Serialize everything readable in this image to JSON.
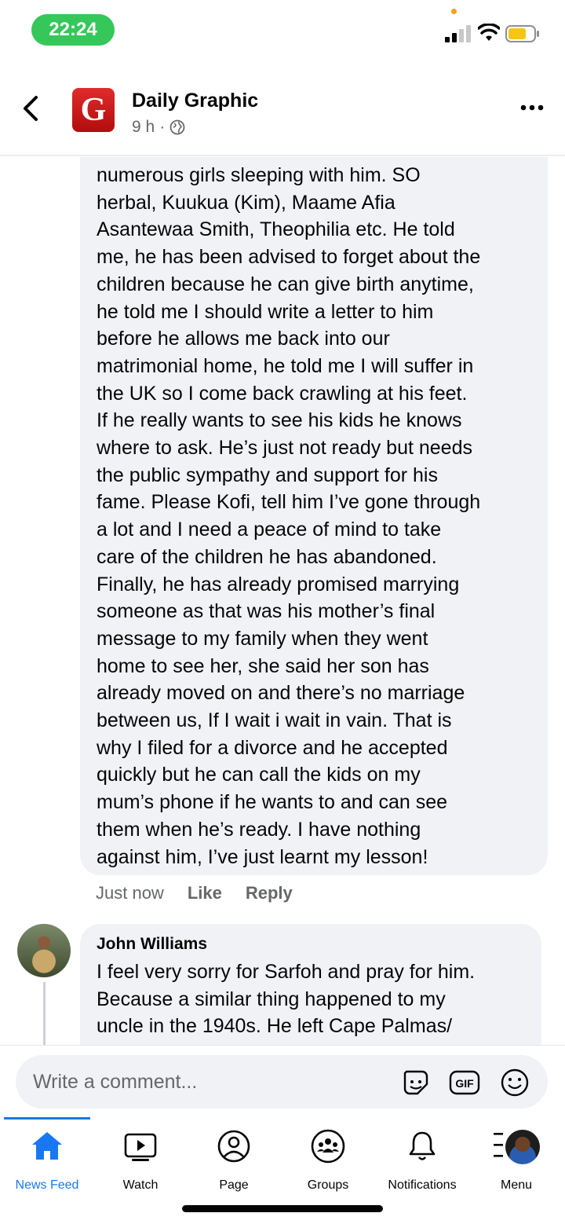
{
  "status_bar": {
    "time": "22:24"
  },
  "header": {
    "page_name": "Daily Graphic",
    "logo_letter": "G",
    "post_age": "9 h",
    "separator": "·",
    "icons": {
      "back": "chevron-left-icon",
      "privacy": "globe-icon",
      "more": "more-horizontal-icon"
    }
  },
  "comment": {
    "text": "numerous girls sleeping with him. SO\nherbal, Kuukua (Kim), Maame Afia\nAsantewaa Smith, Theophilia etc. He told\nme, he has been advised to forget about the\nchildren because he can give birth anytime,\nhe told me I should write a letter to him\nbefore he allows me back into our\nmatrimonial home, he told me I will suffer in\nthe UK so I come back crawling at his feet.\nIf he really wants to see his kids he knows\nwhere to ask. He’s just not ready but needs\nthe public sympathy and support for his\nfame. Please Kofi, tell him I’ve gone through\na lot and I need a peace of mind to take\ncare of the children he has abandoned.\nFinally, he has already promised marrying\nsomeone as that was his mother’s final\nmessage to my family when they went\nhome to see her, she said her son has\nalready moved on and there’s no marriage\nbetween us, If I wait i wait in vain. That is\nwhy I filed for a divorce and he accepted\nquickly but he can call the kids on my\nmum’s phone if he wants to and can see\nthem when he’s ready. I have nothing\nagainst him, I’ve just learnt my lesson!",
    "timestamp": "Just now",
    "like_label": "Like",
    "reply_label": "Reply"
  },
  "reply": {
    "author": "John Williams",
    "text": "I feel very sorry for Sarfoh and pray for him.\nBecause a similar thing happened to my\nuncle in the 1940s. He left Cape Palmas/"
  },
  "composer": {
    "placeholder": "Write a comment...",
    "icons": [
      "sticker-icon",
      "gif-icon",
      "emoji-icon"
    ],
    "gif_label": "GIF"
  },
  "tabbar": {
    "tabs": [
      {
        "label": "News Feed",
        "icon": "home-icon",
        "active": true
      },
      {
        "label": "Watch",
        "icon": "play-video-icon",
        "active": false
      },
      {
        "label": "Page",
        "icon": "profile-icon",
        "active": false
      },
      {
        "label": "Groups",
        "icon": "groups-icon",
        "active": false
      },
      {
        "label": "Notifications",
        "icon": "bell-icon",
        "active": false
      },
      {
        "label": "Menu",
        "icon": "menu-avatar",
        "active": false
      }
    ]
  },
  "colors": {
    "accent": "#1877f2",
    "status_green": "#35c759",
    "bubble": "#f0f2f5",
    "muted_text": "#65676b",
    "logo_red": "#d21f1f",
    "battery_yellow": "#f5c518"
  }
}
